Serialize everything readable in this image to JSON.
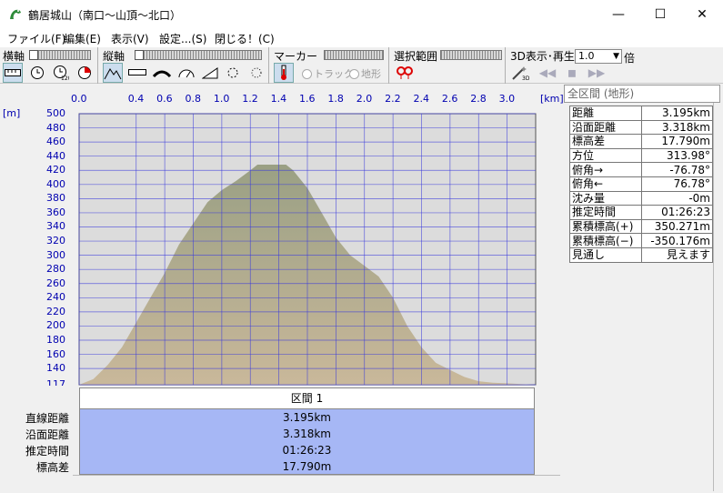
{
  "window": {
    "title": "鶴居城山（南口〜山頂〜北口）"
  },
  "menu": [
    "ファイル(F)",
    "編集(E)",
    "表示(V)",
    "設定...(S)",
    "閉じる！(C)"
  ],
  "toolbar": {
    "horizontal_axis_label": "横軸",
    "vertical_axis_label": "縦軸",
    "marker_label": "マーカー",
    "selection_label": "選択範囲",
    "display3d_label": "3D表示･再生",
    "radio_track": "トラック",
    "radio_terrain": "地形",
    "zoom_value": "1.0",
    "zoom_unit": "倍"
  },
  "chart_data": {
    "type": "area",
    "x_unit": "[km]",
    "y_unit": "[m]",
    "x_ticks": [
      "0.0",
      "0.4",
      "0.6",
      "0.8",
      "1.0",
      "1.2",
      "1.4",
      "1.6",
      "1.8",
      "2.0",
      "2.2",
      "2.4",
      "2.6",
      "2.8",
      "3.0"
    ],
    "y_ticks": [
      "500",
      "480",
      "460",
      "440",
      "420",
      "400",
      "380",
      "360",
      "340",
      "320",
      "300",
      "280",
      "260",
      "240",
      "220",
      "200",
      "180",
      "160",
      "140",
      "117"
    ],
    "xlim": [
      0,
      3.2
    ],
    "ylim": [
      117,
      500
    ],
    "x": [
      0.0,
      0.1,
      0.2,
      0.3,
      0.4,
      0.5,
      0.6,
      0.7,
      0.8,
      0.9,
      1.0,
      1.1,
      1.2,
      1.25,
      1.3,
      1.4,
      1.45,
      1.5,
      1.6,
      1.7,
      1.8,
      1.9,
      2.0,
      2.1,
      2.2,
      2.3,
      2.4,
      2.5,
      2.6,
      2.7,
      2.8,
      2.9,
      3.0,
      3.1,
      3.195
    ],
    "y": [
      117,
      125,
      145,
      170,
      205,
      240,
      275,
      315,
      345,
      375,
      392,
      405,
      420,
      428,
      428,
      428,
      428,
      420,
      395,
      360,
      325,
      300,
      285,
      270,
      240,
      200,
      170,
      148,
      138,
      128,
      122,
      120,
      119,
      118,
      117
    ],
    "colors": {
      "fill_top": "#9aa084",
      "fill_bottom": "#c9b89a",
      "plot_bg": "#dcdcdc",
      "grid": "#3a3adc",
      "axis_text": "#0000b0"
    }
  },
  "info": {
    "header": "全区間 (地形)",
    "rows": [
      {
        "label": "距離",
        "value": "3.195km"
      },
      {
        "label": "沿面距離",
        "value": "3.318km"
      },
      {
        "label": "標高差",
        "value": "17.790m"
      },
      {
        "label": "方位",
        "value": "313.98°"
      },
      {
        "label": "俯角→",
        "value": "-76.78°"
      },
      {
        "label": "俯角←",
        "value": "76.78°"
      },
      {
        "label": "沈み量",
        "value": "-0m"
      },
      {
        "label": "推定時間",
        "value": "01:26:23"
      },
      {
        "label": "累積標高(+)",
        "value": "350.271m"
      },
      {
        "label": "累積標高(−)",
        "value": "-350.176m"
      },
      {
        "label": "見通し",
        "value": "見えます"
      }
    ]
  },
  "section": {
    "title": "区間 1",
    "row_labels": [
      "直線距離",
      "沿面距離",
      "推定時間",
      "標高差"
    ],
    "values": [
      "3.195km",
      "3.318km",
      "01:26:23",
      "17.790m"
    ]
  }
}
